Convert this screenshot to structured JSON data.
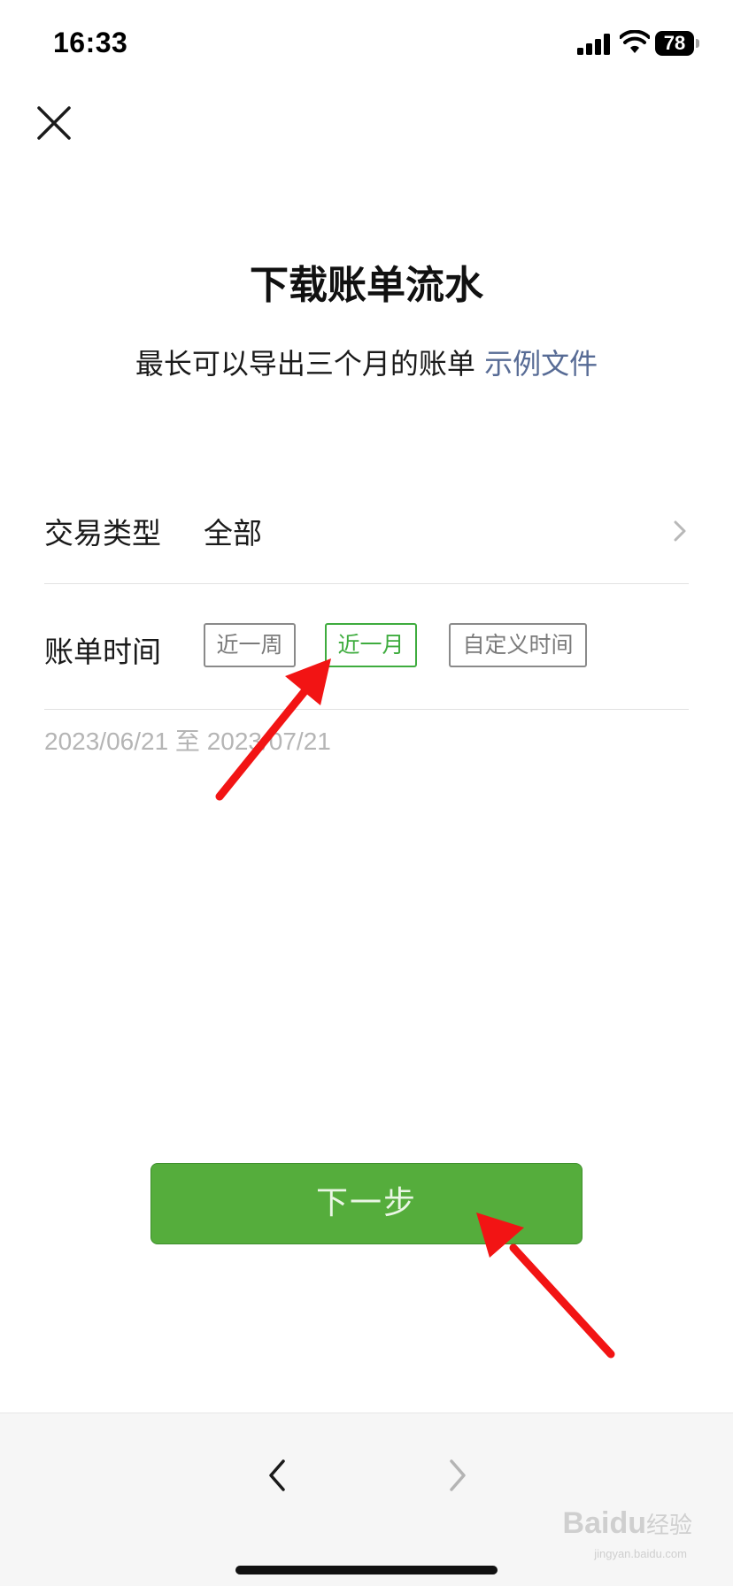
{
  "status_bar": {
    "time": "16:33",
    "battery": "78"
  },
  "header": {
    "title": "下载账单流水",
    "subtitle": "最长可以导出三个月的账单",
    "sample_link": "示例文件"
  },
  "transaction_type": {
    "label": "交易类型",
    "value": "全部"
  },
  "bill_time": {
    "label": "账单时间",
    "options": [
      "近一周",
      "近一月",
      "自定义时间"
    ],
    "selected": "近一月"
  },
  "date_range": "2023/06/21 至 2023/07/21",
  "next_button": "下一步",
  "watermark": {
    "brand": "Baidu",
    "brand_cn": "经验",
    "url": "jingyan.baidu.com"
  },
  "colors": {
    "accent_green": "#55ad3c",
    "link_blue": "#576b95",
    "annotation_red": "#ff1a1a"
  },
  "icons": [
    "close-icon",
    "chevron-right-icon",
    "back-arrow-icon",
    "forward-arrow-icon",
    "signal-icon",
    "wifi-icon",
    "battery-icon"
  ]
}
